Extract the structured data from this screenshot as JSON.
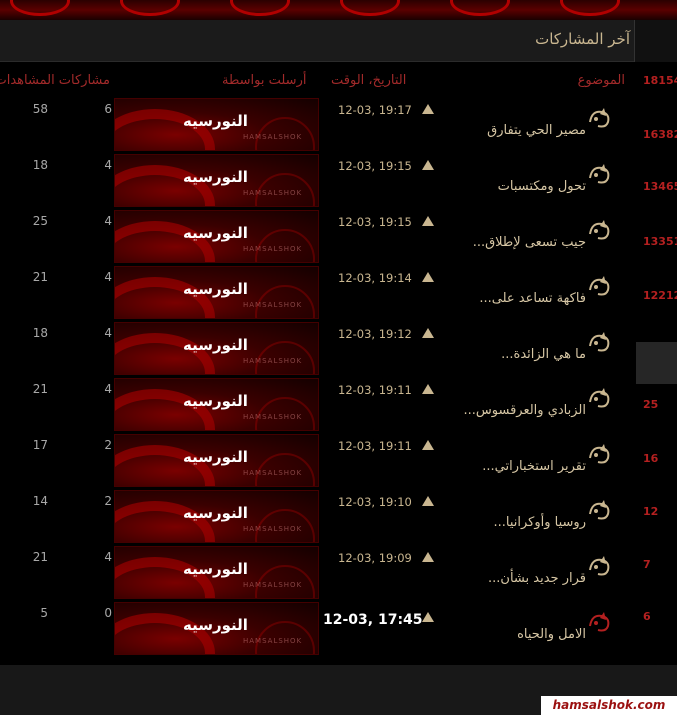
{
  "header": {
    "title": "آخر المشاركات"
  },
  "columns": {
    "topic": "الموضوع",
    "datetime": "التاريخ، الوقت",
    "posted_by": "أرسلت بواسطة",
    "views": "مشاركات المشاهدات"
  },
  "right_column_numbers": [
    "18154",
    "16382",
    "13465",
    "13351",
    "12212",
    "",
    "25",
    "16",
    "12",
    "7",
    "6"
  ],
  "rows": [
    {
      "title": "مصير الحي يتفارق",
      "date": "12-03, 19:17",
      "poster": "النورسيه",
      "replies": "6",
      "views": "58"
    },
    {
      "title": "تحول ومكتسبات",
      "date": "12-03, 19:15",
      "poster": "النورسيه",
      "replies": "4",
      "views": "18"
    },
    {
      "title": "جيب تسعى لإطلاق...",
      "date": "12-03, 19:15",
      "poster": "النورسيه",
      "replies": "4",
      "views": "25"
    },
    {
      "title": "فاكهة تساعد على...",
      "date": "12-03, 19:14",
      "poster": "النورسيه",
      "replies": "4",
      "views": "21"
    },
    {
      "title": "ما هي الزائدة...",
      "date": "12-03, 19:12",
      "poster": "النورسيه",
      "replies": "4",
      "views": "18"
    },
    {
      "title": "الزبادي والعرقسوس...",
      "date": "12-03, 19:11",
      "poster": "النورسيه",
      "replies": "4",
      "views": "21"
    },
    {
      "title": "تقرير استخباراتي...",
      "date": "12-03, 19:11",
      "poster": "النورسيه",
      "replies": "2",
      "views": "17"
    },
    {
      "title": "روسيا وأوكرانيا...",
      "date": "12-03, 19:10",
      "poster": "النورسيه",
      "replies": "2",
      "views": "14"
    },
    {
      "title": "قرار جديد بشأن...",
      "date": "12-03, 19:09",
      "poster": "النورسيه",
      "replies": "4",
      "views": "21"
    },
    {
      "title": "الامل والحياه",
      "date": "12-03, 17:45",
      "poster": "النورسيه",
      "replies": "0",
      "views": "5"
    }
  ],
  "poster_watermark": "HAMSALSHOK",
  "footer": {
    "site": "hamsalshok.com"
  },
  "colors": {
    "accent_red": "#b42020",
    "text_gold": "#c9b690",
    "background": "#000000"
  }
}
